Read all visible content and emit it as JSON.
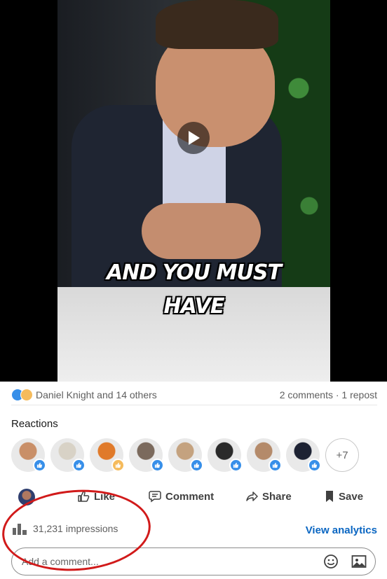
{
  "video": {
    "caption_line1": "AND YOU MUST",
    "caption_line2": "HAVE"
  },
  "counts": {
    "reactors_text": "Daniel Knight and 14 others",
    "comments_reposts_text": "2 comments · 1 repost"
  },
  "reactions": {
    "title": "Reactions",
    "more_label": "+7",
    "avatars": [
      {
        "color": "#c98f68",
        "reaction": "like"
      },
      {
        "color": "#d8d2c6",
        "reaction": "like"
      },
      {
        "color": "#e07a2a",
        "reaction": "celebrate"
      },
      {
        "color": "#7b6a5d",
        "reaction": "like"
      },
      {
        "color": "#c4a27f",
        "reaction": "like"
      },
      {
        "color": "#2a2a2a",
        "reaction": "like"
      },
      {
        "color": "#b48a6a",
        "reaction": "like"
      },
      {
        "color": "#1d2233",
        "reaction": "like"
      }
    ]
  },
  "actions": {
    "like": "Like",
    "comment": "Comment",
    "share": "Share",
    "save": "Save"
  },
  "analytics": {
    "impressions_text": "31,231 impressions",
    "view_analytics": "View analytics"
  },
  "comment_box": {
    "placeholder": "Add a comment..."
  },
  "colors": {
    "accent": "#0a66c2",
    "annotation": "#d11a1a",
    "like_blue": "#378fe9",
    "celebrate_gold": "#f5bb5c"
  }
}
